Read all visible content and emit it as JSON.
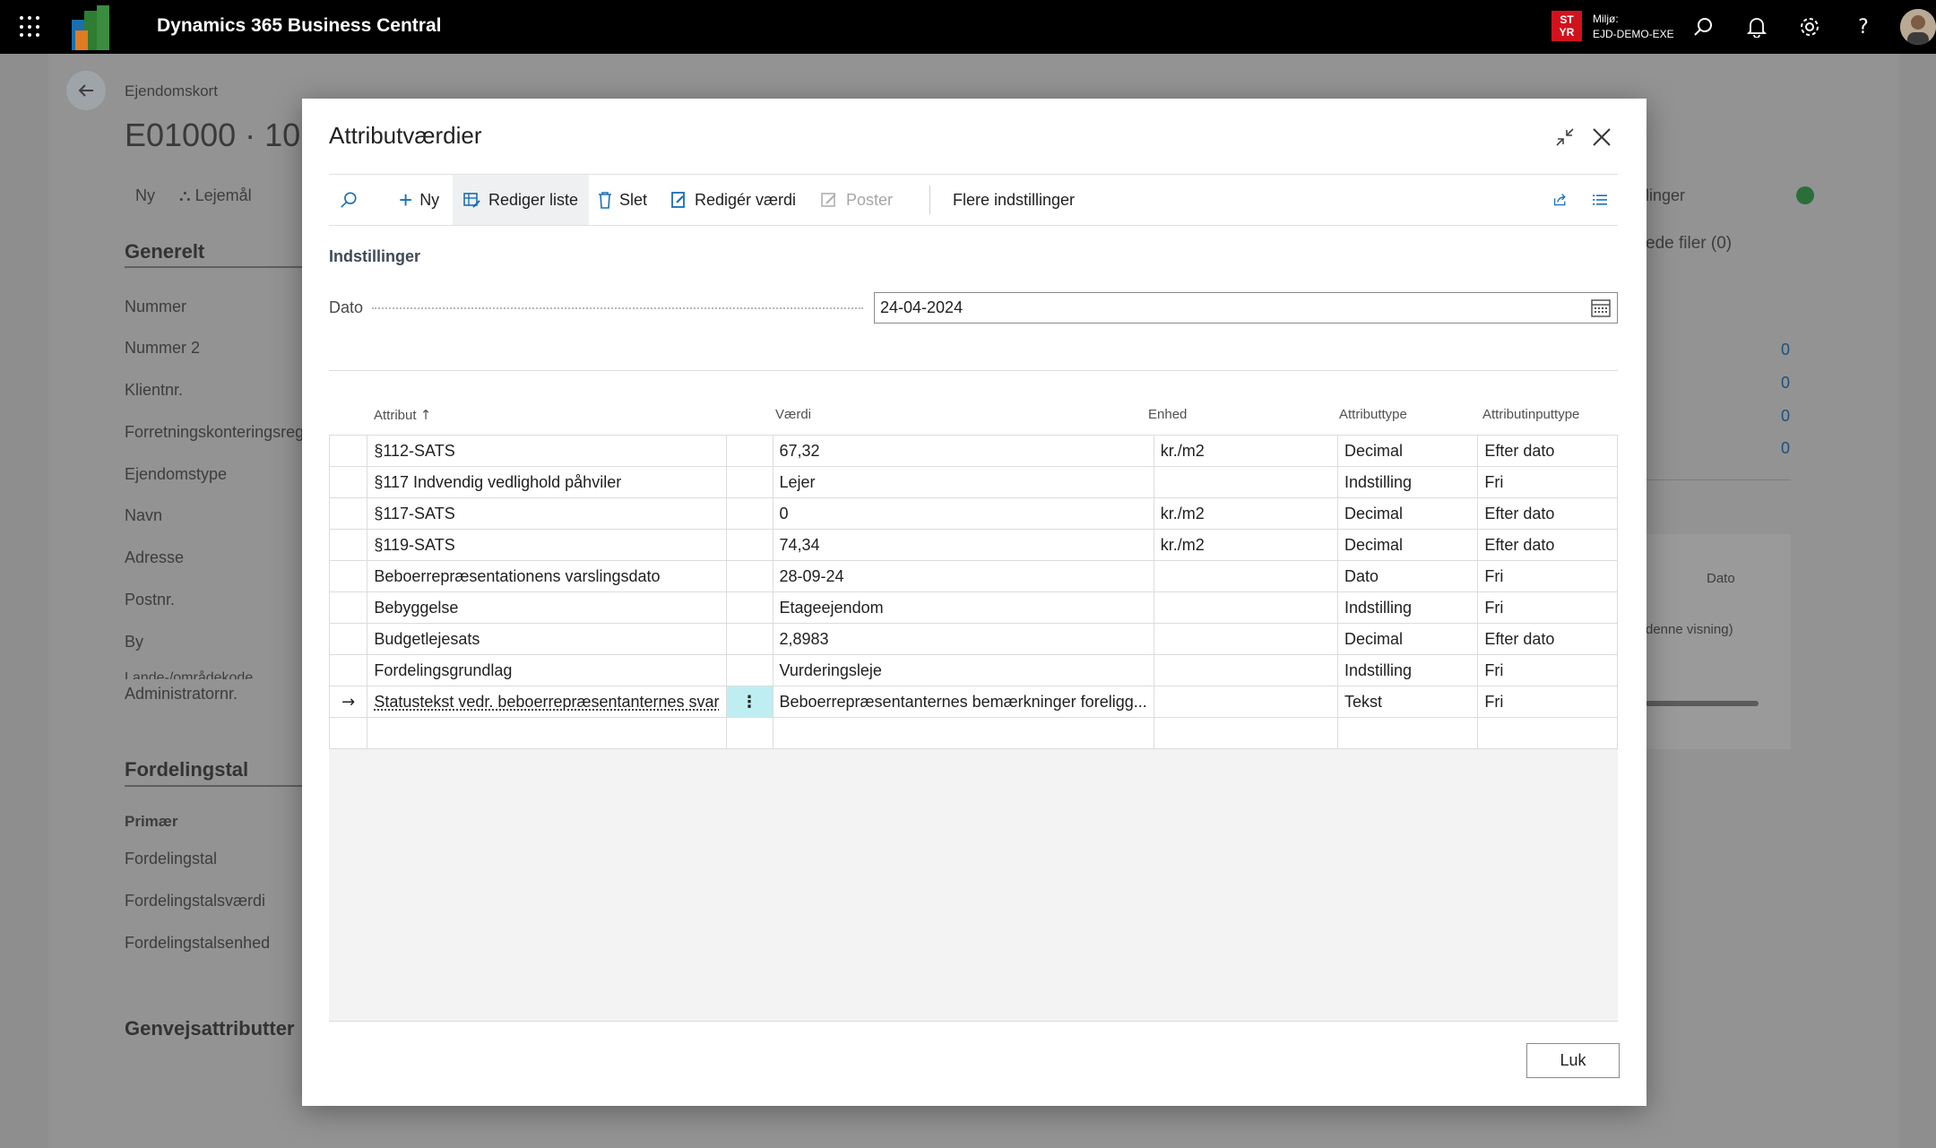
{
  "topbar": {
    "app_title": "Dynamics 365 Business Central",
    "env_badge": [
      "ST",
      "YR"
    ],
    "env_label": "Miljø:",
    "env_name": "EJD-DEMO-EXE"
  },
  "background": {
    "breadcrumb": "Ejendomskort",
    "record_title": "E01000 · 10 ·",
    "action_new": "Ny",
    "action_lejemaal": "Lejemål",
    "right_tab_fragment": "linger",
    "attached_files": "ede filer (0)",
    "section_general": "Generelt",
    "fields": [
      "Nummer",
      "Nummer 2",
      "Klientnr.",
      "Forretningskonteringsreg",
      "Ejendomstype",
      "Navn",
      "Adresse",
      "Postnr.",
      "By",
      "Lande-/områdekode",
      "Administratornr."
    ],
    "section_distribution": "Fordelingstal",
    "distribution_primary": "Primær",
    "distribution_fields": [
      "Fordelingstal",
      "Fordelingstalsværdi",
      "Fordelingstalsenhed"
    ],
    "section_shortcuts": "Genvejsattributter",
    "right_counts": [
      "0",
      "0",
      "0",
      "0"
    ],
    "right_col_dato": "Dato",
    "right_view_note": "denne visning)"
  },
  "dialog": {
    "title": "Attributværdier",
    "toolbar": {
      "search_label": "Søg",
      "new_label": "Ny",
      "edit_list_label": "Rediger liste",
      "delete_label": "Slet",
      "edit_value_label": "Redigér værdi",
      "post_label": "Poster",
      "more_label": "Flere indstillinger"
    },
    "settings_title": "Indstillinger",
    "date_label": "Dato",
    "date_value": "24-04-2024",
    "columns": {
      "attribute": "Attribut",
      "value": "Værdi",
      "unit": "Enhed",
      "type": "Attributtype",
      "input_type": "Attributinputtype"
    },
    "rows": [
      {
        "attribute": "§112-SATS",
        "value": "67,32",
        "unit": "kr./m2",
        "type": "Decimal",
        "input_type": "Efter dato"
      },
      {
        "attribute": "§117 Indvendig vedlighold påhviler",
        "value": "Lejer",
        "unit": "",
        "type": "Indstilling",
        "input_type": "Fri"
      },
      {
        "attribute": "§117-SATS",
        "value": "0",
        "unit": "kr./m2",
        "type": "Decimal",
        "input_type": "Efter dato"
      },
      {
        "attribute": "§119-SATS",
        "value": "74,34",
        "unit": "kr./m2",
        "type": "Decimal",
        "input_type": "Efter dato"
      },
      {
        "attribute": "Beboerrepræsentationens varslingsdato",
        "value": "28-09-24",
        "unit": "",
        "type": "Dato",
        "input_type": "Fri"
      },
      {
        "attribute": "Bebyggelse",
        "value": "Etageejendom",
        "unit": "",
        "type": "Indstilling",
        "input_type": "Fri"
      },
      {
        "attribute": "Budgetlejesats",
        "value": "2,8983",
        "unit": "",
        "type": "Decimal",
        "input_type": "Efter dato"
      },
      {
        "attribute": "Fordelingsgrundlag",
        "value": "Vurderingsleje",
        "unit": "",
        "type": "Indstilling",
        "input_type": "Fri"
      },
      {
        "attribute": "Statustekst vedr. beboerrepræsentanternes svar",
        "value": "Beboerrepræsentanternes bemærkninger foreligg...",
        "unit": "",
        "type": "Tekst",
        "input_type": "Fri"
      }
    ],
    "selected_row_index": 8,
    "close_button": "Luk"
  }
}
